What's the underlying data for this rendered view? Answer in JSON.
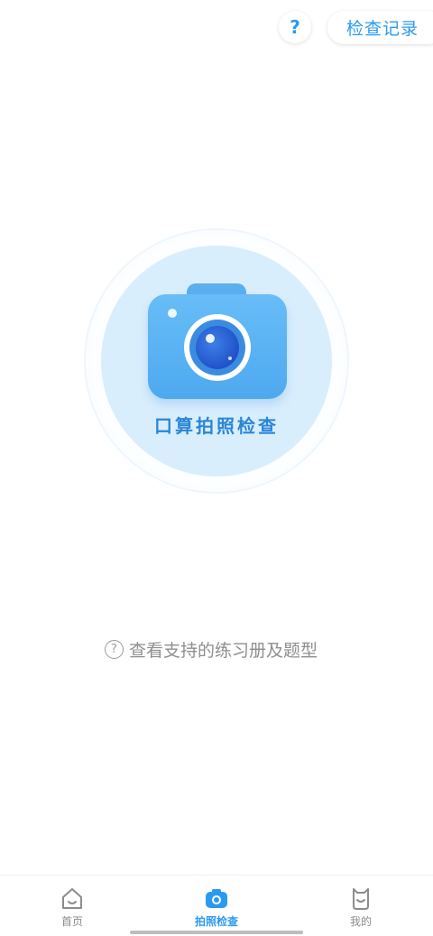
{
  "header": {
    "help_glyph": "?",
    "records_label": "检查记录"
  },
  "capture": {
    "label": "口算拍照检查"
  },
  "supported": {
    "text": "查看支持的练习册及题型"
  },
  "bottom_nav": {
    "items": [
      {
        "label": "首页",
        "icon": "home-icon"
      },
      {
        "label": "拍照检查",
        "icon": "camera-icon"
      },
      {
        "label": "我的",
        "icon": "profile-icon"
      }
    ],
    "active_index": 1
  },
  "colors": {
    "accent": "#2a9af0",
    "camera_body": "#5aaff0",
    "circle_bg": "#d9eefc",
    "inactive": "#8c8c8c"
  }
}
